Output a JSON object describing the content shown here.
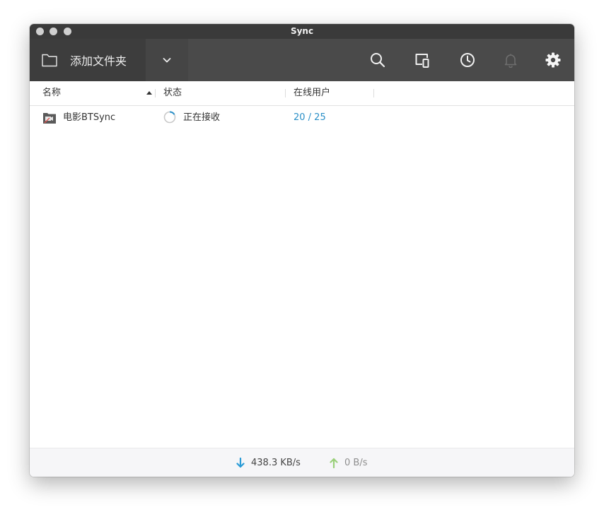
{
  "window": {
    "title": "Sync"
  },
  "toolbar": {
    "add_folder_label": "添加文件夹",
    "icons": [
      "folder-icon",
      "chevron-down-icon",
      "search-icon",
      "devices-icon",
      "history-icon",
      "bell-icon",
      "gear-icon"
    ]
  },
  "table": {
    "columns": [
      "名称",
      "状态",
      "在线用户"
    ],
    "sort": {
      "column": "名称",
      "direction": "ascending"
    },
    "rows": [
      {
        "name": "电影BTSync",
        "status": "正在接收",
        "peers": "20 / 25"
      }
    ]
  },
  "statusbar": {
    "download": "438.3 KB/s",
    "upload": "0 B/s"
  },
  "colors": {
    "toolbar": "#4a4a4a",
    "accent": "#2a8fc7",
    "download_arrow": "#2a9bd6",
    "upload_arrow": "#9ad07a"
  }
}
